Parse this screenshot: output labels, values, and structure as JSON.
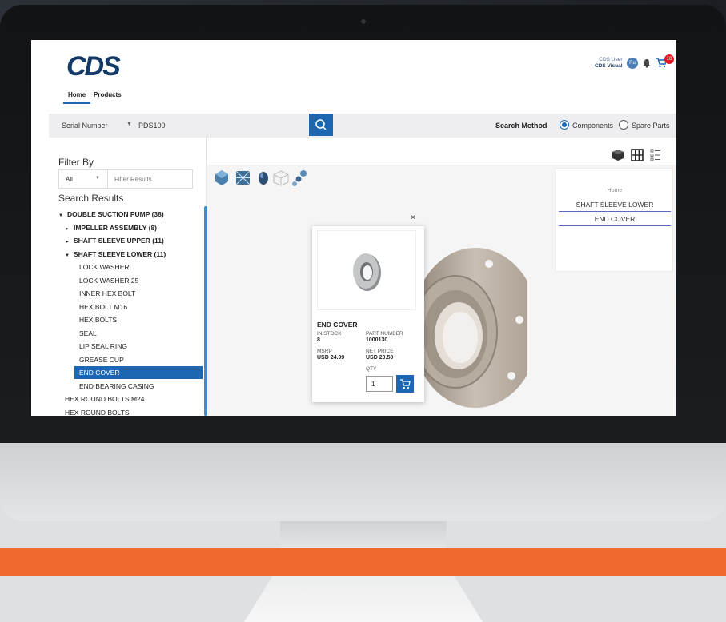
{
  "header": {
    "logo": "CDS",
    "nav": {
      "home": "Home",
      "products": "Products"
    },
    "user": {
      "name": "CDS User",
      "org": "CDS Visual",
      "initials": "Ru"
    },
    "cart_count": "10"
  },
  "search": {
    "type_select": "Serial Number",
    "value": "PDS100",
    "method_label": "Search Method",
    "options": [
      "Components",
      "Spare Parts"
    ],
    "selected_option": "Components"
  },
  "filter": {
    "title": "Filter By",
    "scope": "All",
    "placeholder": "Filter Results"
  },
  "results": {
    "title": "Search Results",
    "tree": [
      {
        "label": "DOUBLE SUCTION PUMP  (38)",
        "arrow": "▼",
        "level": 0,
        "bold": true
      },
      {
        "label": "IMPELLER ASSEMBLY  (8)",
        "arrow": "►",
        "level": 1,
        "bold": true
      },
      {
        "label": "SHAFT SLEEVE UPPER  (11)",
        "arrow": "►",
        "level": 1,
        "bold": true
      },
      {
        "label": "SHAFT SLEEVE LOWER  (11)",
        "arrow": "▼",
        "level": 1,
        "bold": true
      },
      {
        "label": "LOCK WASHER",
        "arrow": "",
        "level": 2
      },
      {
        "label": "LOCK WASHER 25",
        "arrow": "",
        "level": 2
      },
      {
        "label": "INNER HEX BOLT",
        "arrow": "",
        "level": 2
      },
      {
        "label": "HEX BOLT M16",
        "arrow": "",
        "level": 2
      },
      {
        "label": "HEX BOLTS",
        "arrow": "",
        "level": 2
      },
      {
        "label": "SEAL",
        "arrow": "",
        "level": 2
      },
      {
        "label": "LIP SEAL RING",
        "arrow": "",
        "level": 2
      },
      {
        "label": "GREASE CUP",
        "arrow": "",
        "level": 2
      },
      {
        "label": "END COVER",
        "arrow": "",
        "level": 2,
        "selected": true
      },
      {
        "label": "END BEARING CASING",
        "arrow": "",
        "level": 2
      },
      {
        "label": "HEX ROUND BOLTS M24",
        "arrow": "",
        "level": 1
      },
      {
        "label": "HEX ROUND BOLTS",
        "arrow": "",
        "level": 1
      }
    ]
  },
  "breadcrumb": {
    "home": "Home",
    "items": [
      "SHAFT SLEEVE LOWER",
      "END COVER"
    ]
  },
  "popup": {
    "close": "×",
    "title": "END COVER",
    "in_stock_label": "IN STOCK",
    "in_stock": "8",
    "part_number_label": "PART NUMBER",
    "part_number": "1000130",
    "msrp_label": "MSRP",
    "msrp": "USD 24.99",
    "net_price_label": "NET PRICE",
    "net_price": "USD 20.50",
    "qty_label": "QTY",
    "qty": "1"
  },
  "colors": {
    "brand_blue": "#1b67b2",
    "logo_navy": "#143a67",
    "accent_orange": "#ee6a2f"
  }
}
